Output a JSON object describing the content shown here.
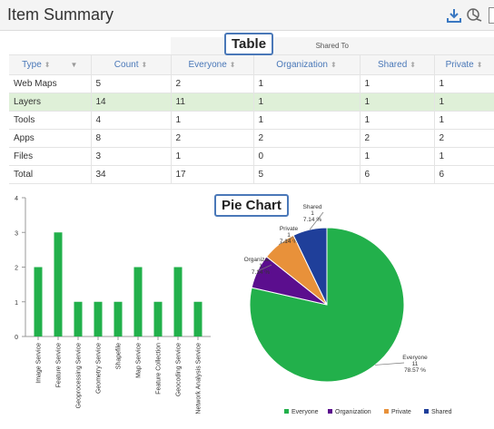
{
  "header": {
    "title": "Item Summary"
  },
  "icons": {
    "download": "download-icon",
    "chart_settings": "chart-settings-icon"
  },
  "annotations": {
    "table": "Table",
    "pie": "Pie Chart"
  },
  "table": {
    "group_header": "Shared To",
    "columns": [
      "Type",
      "Count",
      "Everyone",
      "Organization",
      "Shared",
      "Private"
    ],
    "rows": [
      [
        "Web Maps",
        "5",
        "2",
        "1",
        "1",
        "1"
      ],
      [
        "Layers",
        "14",
        "11",
        "1",
        "1",
        "1"
      ],
      [
        "Tools",
        "4",
        "1",
        "1",
        "1",
        "1"
      ],
      [
        "Apps",
        "8",
        "2",
        "2",
        "2",
        "2"
      ],
      [
        "Files",
        "3",
        "1",
        "0",
        "1",
        "1"
      ],
      [
        "Total",
        "34",
        "17",
        "5",
        "6",
        "6"
      ]
    ],
    "highlight_row": 1
  },
  "chart_data": [
    {
      "type": "bar",
      "categories": [
        "Image Service",
        "Feature Service",
        "Geoprocessing Service",
        "Geometry Service",
        "Shapefile",
        "Map Service",
        "Feature Collection",
        "Geocoding Service",
        "Network Analysis Service"
      ],
      "values": [
        2,
        3,
        1,
        1,
        1,
        2,
        1,
        2,
        1
      ],
      "ylim": [
        0,
        4
      ],
      "yticks": [
        "0",
        "1",
        "2",
        "3",
        "4"
      ],
      "color": "#22b04b"
    },
    {
      "type": "pie",
      "slices": [
        {
          "label": "Everyone",
          "value": 11,
          "percent": "78.57 %",
          "color": "#22b04b"
        },
        {
          "label": "Organization",
          "value": 1,
          "percent": "7.14 %",
          "color": "#5b0e8e"
        },
        {
          "label": "Private",
          "value": 1,
          "percent": "7.14 %",
          "color": "#e8913a"
        },
        {
          "label": "Shared",
          "value": 1,
          "percent": "7.14 %",
          "color": "#1f3f9a"
        }
      ],
      "legend": [
        "Everyone",
        "Organization",
        "Private",
        "Shared"
      ],
      "legend_position": "bottom"
    }
  ]
}
